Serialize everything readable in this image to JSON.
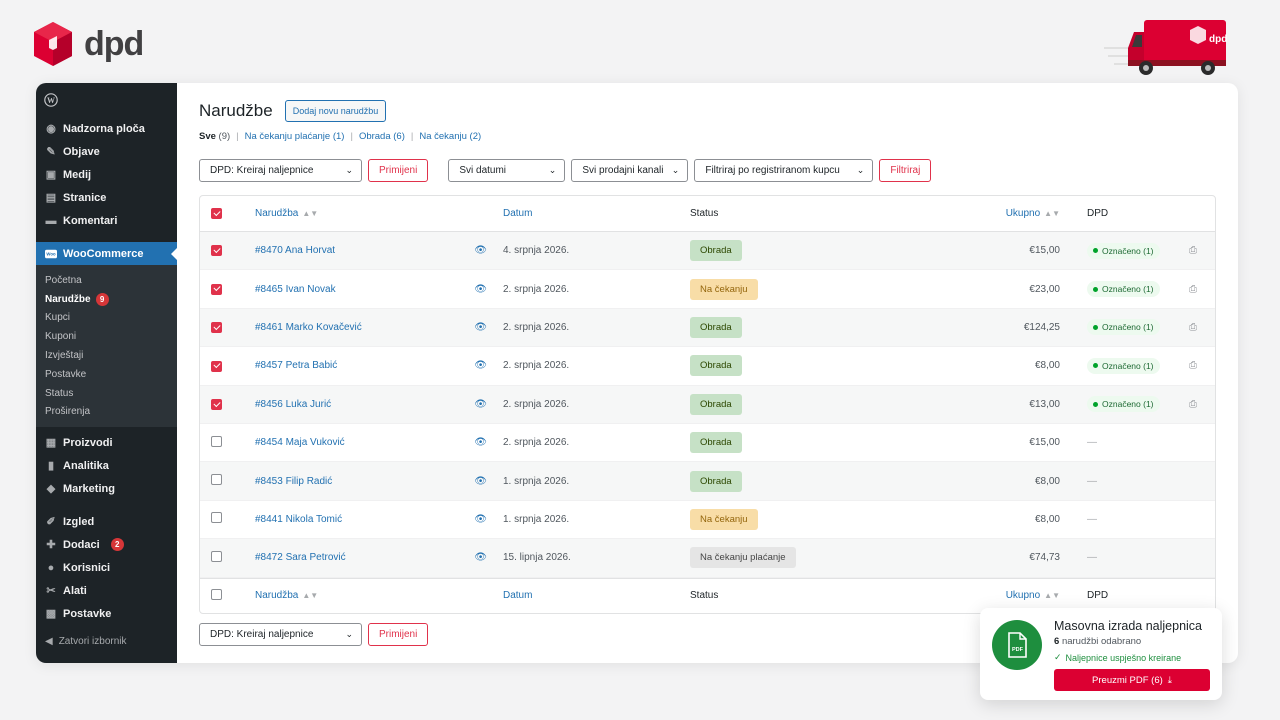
{
  "brand": {
    "logo_text": "dpd",
    "van_logo_text": "dpd",
    "color": "#dc0032"
  },
  "sidebar": {
    "top_items": [
      {
        "label": "Nadzorna ploča",
        "icon": "dashboard-icon"
      },
      {
        "label": "Objave",
        "icon": "pin-icon"
      },
      {
        "label": "Medij",
        "icon": "media-icon"
      },
      {
        "label": "Stranice",
        "icon": "pages-icon"
      },
      {
        "label": "Komentari",
        "icon": "comments-icon"
      }
    ],
    "active_item": {
      "label": "WooCommerce",
      "icon": "woo-icon",
      "icon_text": "Woo"
    },
    "sub_items": [
      "Početna",
      "Narudžbe",
      "Kupci",
      "Kuponi",
      "Izvještaji",
      "Postavke",
      "Status",
      "Proširenja"
    ],
    "sub_current_badge": "9",
    "mid_items": [
      {
        "label": "Proizvodi",
        "icon": "products-icon"
      },
      {
        "label": "Analitika",
        "icon": "analytics-icon"
      },
      {
        "label": "Marketing",
        "icon": "marketing-icon"
      }
    ],
    "bottom_items": [
      {
        "label": "Izgled",
        "icon": "appearance-icon"
      },
      {
        "label": "Dodaci",
        "icon": "plugins-icon",
        "badge": "2"
      },
      {
        "label": "Korisnici",
        "icon": "users-icon"
      },
      {
        "label": "Alati",
        "icon": "tools-icon"
      },
      {
        "label": "Postavke",
        "icon": "settings-icon"
      }
    ],
    "collapse_label": "Zatvori izbornik"
  },
  "header": {
    "title": "Narudžbe",
    "add_button": "Dodaj novu narudžbu"
  },
  "filters_views": [
    {
      "label": "Sve",
      "count": "(9)",
      "current": true
    },
    {
      "label": "Na čekanju plaćanje",
      "count": "(1)"
    },
    {
      "label": "Obrada",
      "count": "(6)"
    },
    {
      "label": "Na čekanju",
      "count": "(2)"
    }
  ],
  "toolbar": {
    "bulk_action": "DPD: Kreiraj naljepnice",
    "apply": "Primijeni",
    "dates": "Svi datumi",
    "channels": "Svi prodajni kanali",
    "customer": "Filtriraj po registriranom kupcu",
    "filter": "Filtriraj"
  },
  "table": {
    "columns": {
      "order": "Narudžba",
      "date": "Datum",
      "status": "Status",
      "total": "Ukupno",
      "dpd": "DPD"
    },
    "rows": [
      {
        "order": "#8470 Ana Horvat",
        "date": "4. srpnja 2026.",
        "status": "Obrada",
        "status_type": "processing",
        "total": "€15,00",
        "dpd": "Označeno (1)",
        "checked": true
      },
      {
        "order": "#8465 Ivan Novak",
        "date": "2. srpnja 2026.",
        "status": "Na čekanju",
        "status_type": "onhold",
        "total": "€23,00",
        "dpd": "Označeno (1)",
        "checked": true
      },
      {
        "order": "#8461 Marko Kovačević",
        "date": "2. srpnja 2026.",
        "status": "Obrada",
        "status_type": "processing",
        "total": "€124,25",
        "dpd": "Označeno (1)",
        "checked": true
      },
      {
        "order": "#8457 Petra Babić",
        "date": "2. srpnja 2026.",
        "status": "Obrada",
        "status_type": "processing",
        "total": "€8,00",
        "dpd": "Označeno (1)",
        "checked": true
      },
      {
        "order": "#8456 Luka Jurić",
        "date": "2. srpnja 2026.",
        "status": "Obrada",
        "status_type": "processing",
        "total": "€13,00",
        "dpd": "Označeno (1)",
        "checked": true
      },
      {
        "order": "#8454 Maja Vuković",
        "date": "2. srpnja 2026.",
        "status": "Obrada",
        "status_type": "processing",
        "total": "€15,00",
        "dpd": "—",
        "checked": false
      },
      {
        "order": "#8453 Filip Radić",
        "date": "1. srpnja 2026.",
        "status": "Obrada",
        "status_type": "processing",
        "total": "€8,00",
        "dpd": "—",
        "checked": false
      },
      {
        "order": "#8441 Nikola Tomić",
        "date": "1. srpnja 2026.",
        "status": "Na čekanju",
        "status_type": "onhold",
        "total": "€8,00",
        "dpd": "—",
        "checked": false
      },
      {
        "order": "#8472 Sara Petrović",
        "date": "15. lipnja 2026.",
        "status": "Na čekanju plaćanje",
        "status_type": "pending",
        "total": "€74,73",
        "dpd": "—",
        "checked": false
      }
    ]
  },
  "toast": {
    "title": "Masovna izrada naljepnica",
    "count": "6",
    "subtitle": "narudžbi odabrano",
    "success": "Naljepnice uspješno kreirane",
    "button": "Preuzmi PDF (6)",
    "icon_text": "PDF"
  }
}
